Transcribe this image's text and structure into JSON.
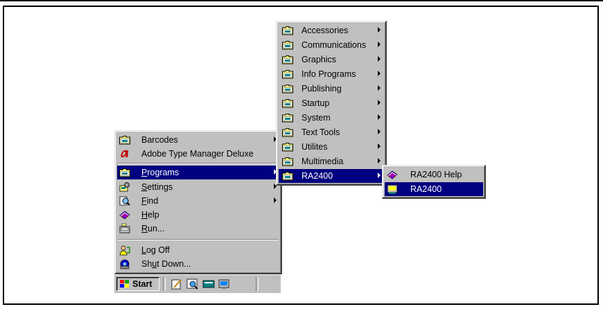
{
  "start_menu": {
    "items": [
      {
        "label": "Barcodes",
        "icon": "folder-icon",
        "submenu": true
      },
      {
        "label": "Adobe Type Manager Deluxe",
        "icon": "adobe-icon",
        "submenu": false
      },
      {
        "label_pre": "",
        "accel": "P",
        "label_post": "rograms",
        "icon": "programs-folder-icon",
        "submenu": true,
        "selected": true
      },
      {
        "label_pre": "",
        "accel": "S",
        "label_post": "ettings",
        "icon": "settings-icon",
        "submenu": true
      },
      {
        "label_pre": "",
        "accel": "F",
        "label_post": "ind",
        "icon": "find-icon",
        "submenu": true
      },
      {
        "label_pre": "",
        "accel": "H",
        "label_post": "elp",
        "icon": "help-icon",
        "submenu": false
      },
      {
        "label_pre": "",
        "accel": "R",
        "label_post": "un...",
        "icon": "run-icon",
        "submenu": false
      },
      {
        "label_pre": "",
        "accel": "L",
        "label_post": "og Off",
        "icon": "log-off-icon",
        "submenu": false
      },
      {
        "label_pre": "Sh",
        "accel": "u",
        "label_post": "t Down...",
        "icon": "shut-down-icon",
        "submenu": false
      }
    ]
  },
  "programs_menu": {
    "items": [
      {
        "label": "Accessories"
      },
      {
        "label": "Communications"
      },
      {
        "label": "Graphics"
      },
      {
        "label": "Info Programs"
      },
      {
        "label": "Publishing"
      },
      {
        "label": "Startup"
      },
      {
        "label": "System"
      },
      {
        "label": "Text Tools"
      },
      {
        "label": "Utilites"
      },
      {
        "label": "Multimedia"
      },
      {
        "label": "RA2400",
        "selected": true
      }
    ]
  },
  "ra2400_menu": {
    "items": [
      {
        "label": "RA2400 Help",
        "icon": "help-book-icon"
      },
      {
        "label": "RA2400",
        "icon": "ra2400-app-icon",
        "selected": true
      }
    ]
  },
  "taskbar": {
    "start_label": "Start",
    "quick_launch": [
      "edit-icon",
      "browser-icon",
      "desktop-icon",
      "channels-icon"
    ]
  },
  "colors": {
    "menu_bg": "#c0c0c0",
    "highlight": "#000080",
    "highlight_text": "#ffffff"
  }
}
